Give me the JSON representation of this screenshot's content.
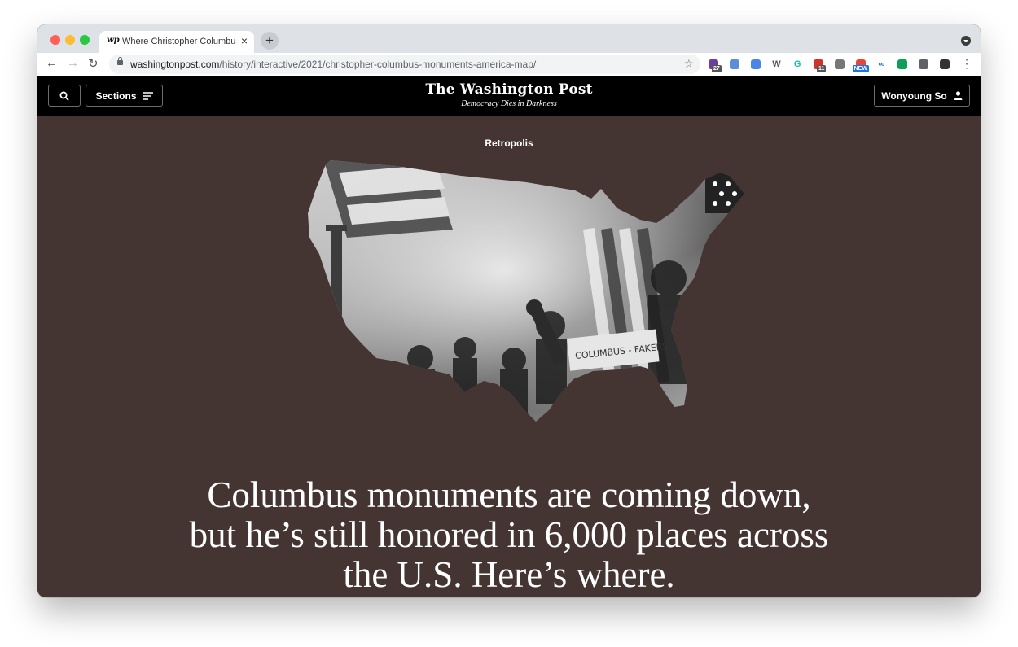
{
  "browser": {
    "tab_title": "Where Christopher Columbus",
    "tab_favicon": "wp",
    "tab_close": "×",
    "new_tab": "+",
    "url_domain": "washingtonpost.com",
    "url_path": "/history/interactive/2021/christopher-columbus-monuments-america-map/",
    "extensions": [
      {
        "icon": "m-extension-icon",
        "badge": "27",
        "color": "#6b3fa0"
      },
      {
        "icon": "circle-extension-icon",
        "color": "#5b8ed6"
      },
      {
        "icon": "doc-extension-icon",
        "color": "#4a86e8"
      },
      {
        "icon": "w-extension-icon",
        "label": "W",
        "color": "#555555"
      },
      {
        "icon": "grammarly-icon",
        "label": "G",
        "color": "#15c39a"
      },
      {
        "icon": "calendar-extension-icon",
        "badge": "11",
        "color": "#d93025"
      },
      {
        "icon": "camera-icon",
        "color": "#777777"
      },
      {
        "icon": "new-extension-icon",
        "badge": "NEW",
        "color": "#e8453c"
      },
      {
        "icon": "infinity-icon",
        "label": "∞",
        "color": "#1a73e8"
      },
      {
        "icon": "heart-shield-icon",
        "color": "#0f9d58"
      },
      {
        "icon": "puzzle-icon",
        "color": "#5f6368"
      },
      {
        "icon": "profile-avatar-icon",
        "color": "#333333"
      }
    ]
  },
  "header": {
    "sections_label": "Sections",
    "masthead": "The Washington Post",
    "slogan": "Democracy Dies in Darkness",
    "account_label": "Wonyoung So"
  },
  "article": {
    "kicker": "Retropolis",
    "headline": "Columbus monuments are coming down, but he’s still honored in 6,000 places across the U.S. Here’s where.",
    "map_sign_text": "COLUMBUS - FAKERS",
    "background_color": "#453532"
  }
}
